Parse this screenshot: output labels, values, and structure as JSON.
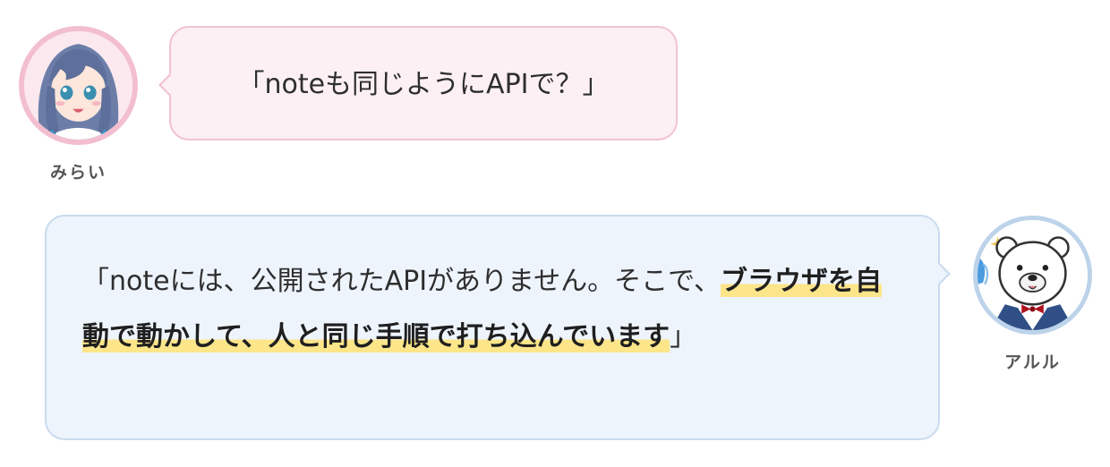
{
  "speakers": {
    "mirai": {
      "name": "みらい",
      "icon": "girl-avatar-icon",
      "accent": "#f3bfd0",
      "bubble_bg": "#fdf0f4"
    },
    "aruru": {
      "name": "アルル",
      "icon": "polar-bear-avatar-icon",
      "accent": "#bcd3ea",
      "bubble_bg": "#eef4fc"
    }
  },
  "messages": {
    "mirai": {
      "text": "「noteも同じようにAPIで？」"
    },
    "aruru": {
      "text_plain": "「noteには、公開されたAPIがありません。そこで、",
      "text_highlight": "ブラウザを自動で動かして、人と同じ手順で打ち込んでいます",
      "text_end": "」",
      "highlight_color": "#fde58a"
    }
  }
}
